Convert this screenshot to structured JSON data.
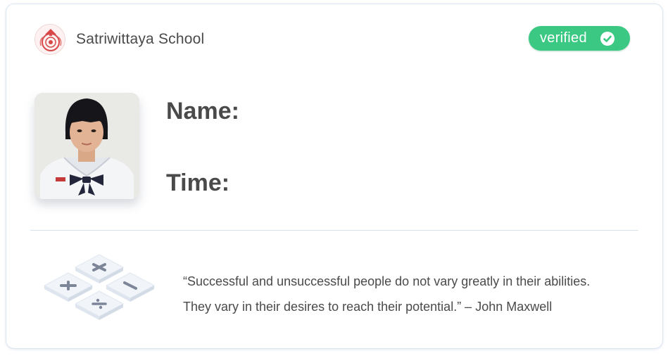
{
  "school": {
    "name": "Satriwittaya School",
    "logo_icon": "school-crest-icon"
  },
  "status": {
    "label": "verified",
    "icon": "check-circle-icon",
    "color": "#3ac882"
  },
  "student": {
    "photo": "student-photo",
    "name_label": "Name:",
    "name_value": "",
    "time_label": "Time:",
    "time_value": ""
  },
  "footer": {
    "icon": "math-operators-icon",
    "quote_line1": "“Successful and unsuccessful people do not vary greatly in their abilities.",
    "quote_line2": "They vary in their desires to reach their potential.” – John Maxwell"
  }
}
